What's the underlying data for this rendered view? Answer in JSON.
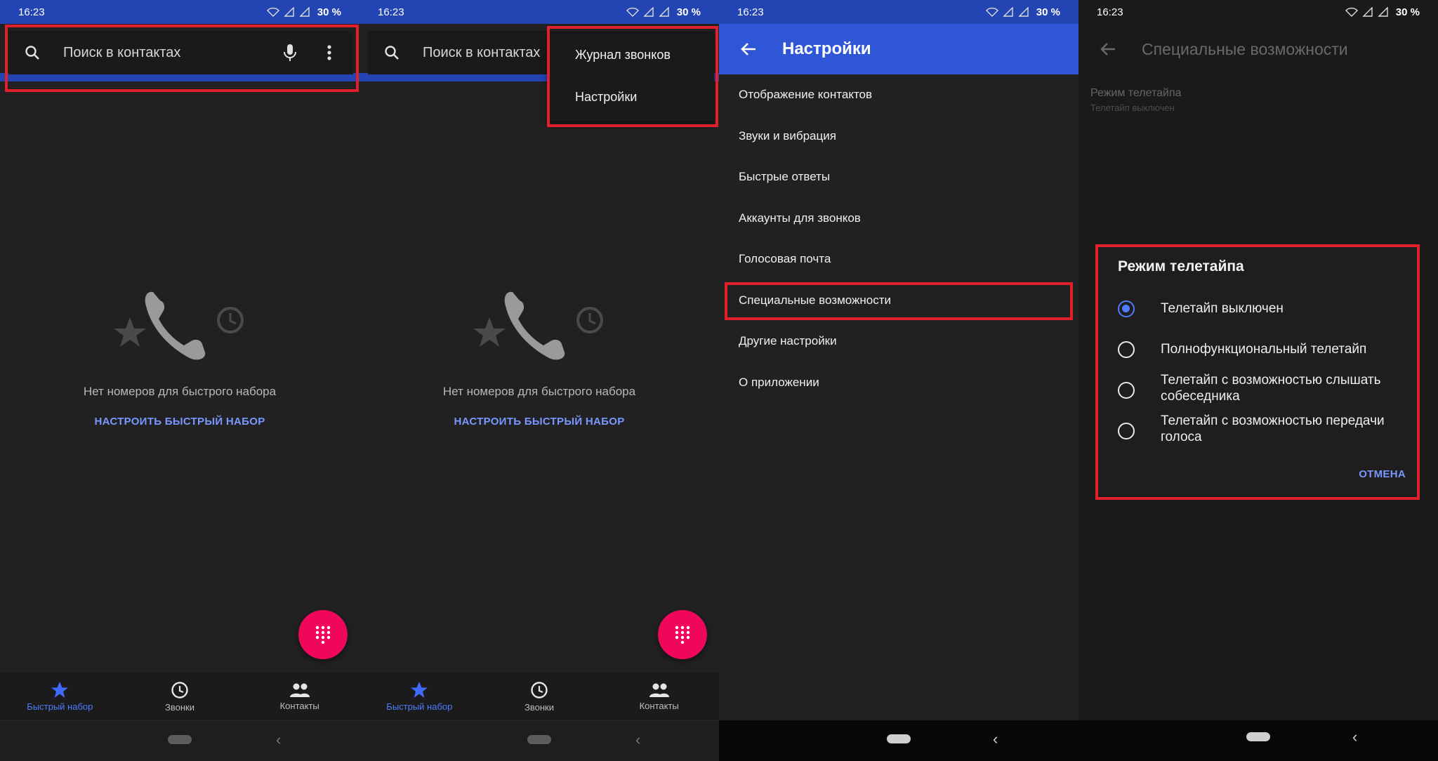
{
  "status": {
    "time": "16:23",
    "battery": "30 %"
  },
  "search": {
    "placeholder": "Поиск в контактах"
  },
  "empty_state": {
    "message": "Нет номеров для быстрого набора",
    "action": "НАСТРОИТЬ БЫСТРЫЙ НАБОР"
  },
  "bottom_nav": {
    "items": [
      {
        "label": "Быстрый набор"
      },
      {
        "label": "Звонки"
      },
      {
        "label": "Контакты"
      }
    ]
  },
  "overflow_menu": {
    "items": [
      "Журнал звонков",
      "Настройки"
    ]
  },
  "settings": {
    "title": "Настройки",
    "items": [
      "Отображение контактов",
      "Звуки и вибрация",
      "Быстрые ответы",
      "Аккаунты для звонков",
      "Голосовая почта",
      "Специальные возможности",
      "Другие настройки",
      "О приложении"
    ]
  },
  "accessibility": {
    "title": "Специальные возможности",
    "pref_title": "Режим телетайпа",
    "pref_summary": "Телетайп выключен"
  },
  "tty_dialog": {
    "title": "Режим телетайпа",
    "options": [
      "Телетайп выключен",
      "Полнофункциональный телетайп",
      "Телетайп с возможностью слышать собеседника",
      "Телетайп с возможностью передачи голоса"
    ],
    "cancel": "ОТМЕНА"
  },
  "colors": {
    "accent_blue": "#2f56d6",
    "fab_pink": "#f0075c",
    "highlight_red": "#e0202a",
    "link_blue": "#7a97ff"
  }
}
